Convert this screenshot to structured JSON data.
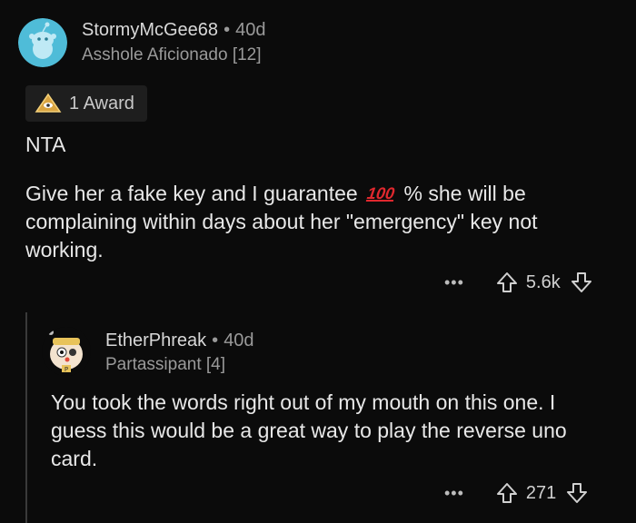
{
  "comment": {
    "username": "StormyMcGee68",
    "separator": "•",
    "age": "40d",
    "flair": "Asshole Aficionado [12]",
    "award_label": "1 Award",
    "line1": "NTA",
    "body_part1": "Give her a fake key and I guarantee",
    "emoji_100": "100",
    "body_part2": "% she will be complaining within days about her \"emergency\" key not working.",
    "more_label": "•••",
    "score": "5.6k"
  },
  "reply": {
    "username": "EtherPhreak",
    "separator": "•",
    "age": "40d",
    "flair": "Partassipant [4]",
    "body": "You took the words right out of my mouth on this one. I guess this would be a great way to play the reverse uno card.",
    "more_label": "•••",
    "score": "271"
  },
  "colors": {
    "background": "#0b0b0b",
    "avatar_bg": "#4fbcd8",
    "text": "#e8e8e8",
    "meta": "#9a9a9a",
    "emoji_red": "#e0282e"
  },
  "icons": [
    "snoo-avatar-icon",
    "award-icon",
    "upvote-icon",
    "downvote-icon",
    "more-icon",
    "reply-avatar-icon"
  ]
}
